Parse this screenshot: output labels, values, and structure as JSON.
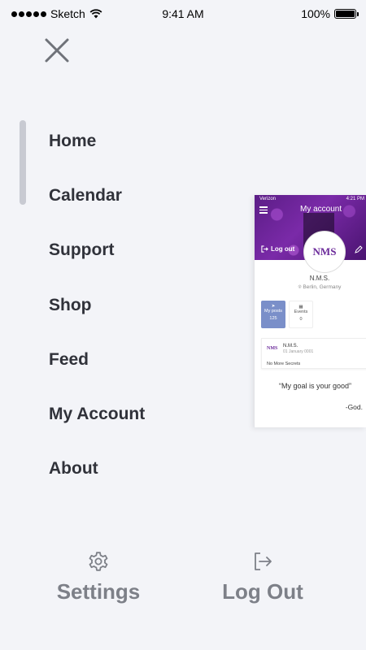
{
  "status_bar": {
    "carrier": "Sketch",
    "time": "9:41 AM",
    "battery": "100%"
  },
  "menu": {
    "items": [
      {
        "label": "Home"
      },
      {
        "label": "Calendar"
      },
      {
        "label": "Support"
      },
      {
        "label": "Shop"
      },
      {
        "label": "Feed"
      },
      {
        "label": "My Account"
      },
      {
        "label": "About"
      }
    ]
  },
  "preview": {
    "carrier": "Verizon",
    "time": "4:21 PM",
    "title": "My account",
    "logout_label": "Log out",
    "logo_text": "NMS",
    "name": "N.M.S.",
    "location": "Berlin, Germany",
    "tabs": [
      {
        "label": "My posts",
        "count": "125"
      },
      {
        "label": "Events",
        "count": "0"
      }
    ],
    "post": {
      "logo": "NMS",
      "author": "N.M.S.",
      "date": "01 January 0001",
      "text": "No More Secrets"
    },
    "quote": "“My goal is your good”",
    "quote_author": "-God."
  },
  "actions": {
    "settings_label": "Settings",
    "logout_label": "Log Out"
  },
  "icons": {
    "close": "close-icon",
    "settings": "gear-icon",
    "logout": "logout-icon"
  }
}
